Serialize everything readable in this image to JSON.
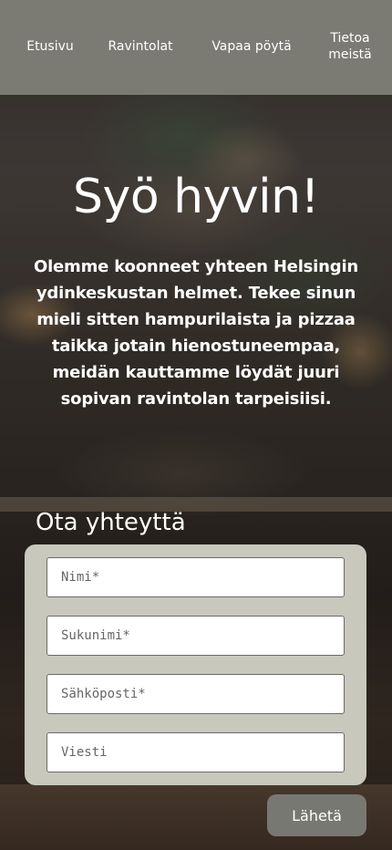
{
  "nav": {
    "home": "Etusivu",
    "restaurants": "Ravintolat",
    "free_table": "Vapaa pöytä",
    "about": "Tietoa meistä"
  },
  "hero": {
    "title": "Syö hyvin!",
    "text": "Olemme koonneet yhteen Helsingin ydinkeskustan helmet. Tekee sinun mieli sitten hampurilaista ja pizzaa taikka jotain hienostuneempaa, meidän kauttamme löydät juuri sopivan ravintolan tarpeisiisi."
  },
  "contact": {
    "heading": "Ota yhteyttä",
    "fields": {
      "first_name": {
        "placeholder": "Nimi*",
        "value": ""
      },
      "last_name": {
        "placeholder": "Sukunimi*",
        "value": ""
      },
      "email": {
        "placeholder": "Sähköposti*",
        "value": ""
      },
      "message": {
        "placeholder": "Viesti",
        "value": ""
      }
    },
    "submit_label": "Lähetä"
  },
  "colors": {
    "nav_bg": "#7b7b73",
    "panel_bg": "#c8c8bd",
    "button_bg": "#787872",
    "text_light": "#ffffff"
  }
}
